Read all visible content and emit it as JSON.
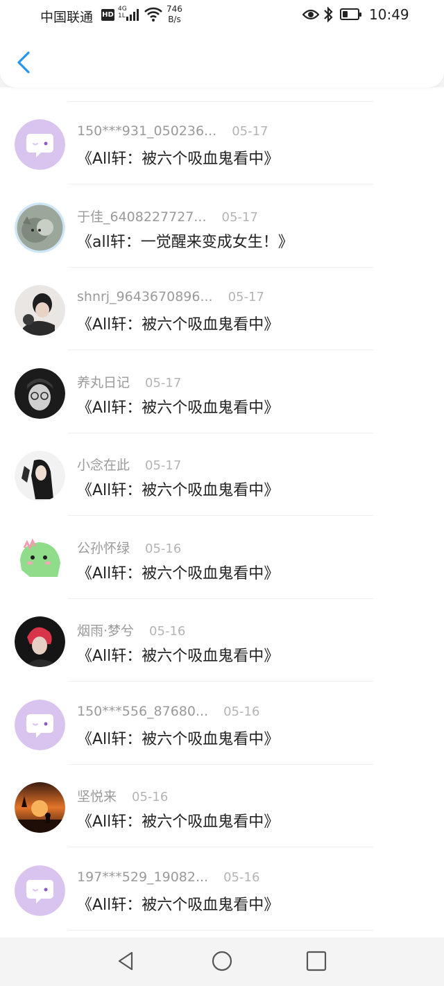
{
  "status_bar": {
    "carrier": "中国联通",
    "hd": "HD",
    "network_top": "4G",
    "network_bottom": "1L",
    "speed_value": "746",
    "speed_unit": "B/s",
    "time": "10:49",
    "battery_level": 0.35
  },
  "header": {
    "back_icon": "chevron-left-icon",
    "accent_color": "#2196f3"
  },
  "items": [
    {
      "name": "150***931_050236...",
      "date": "05-17",
      "title": "《All轩：被六个吸血鬼看中》",
      "avatar": "default-chat"
    },
    {
      "name": "于佳_6408227727...",
      "date": "05-17",
      "title": "《all轩：一觉醒来变成女生！》",
      "avatar": "photo-cat"
    },
    {
      "name": "shnrj_9643670896...",
      "date": "05-17",
      "title": "《All轩：被六个吸血鬼看中》",
      "avatar": "photo-person"
    },
    {
      "name": "养丸日记",
      "date": "05-17",
      "title": "《All轩：被六个吸血鬼看中》",
      "avatar": "photo-glasses"
    },
    {
      "name": "小念在此",
      "date": "05-17",
      "title": "《All轩：被六个吸血鬼看中》",
      "avatar": "photo-girl"
    },
    {
      "name": "公孙怀绿",
      "date": "05-16",
      "title": "《All轩：被六个吸血鬼看中》",
      "avatar": "cartoon-dinosaur"
    },
    {
      "name": "烟雨·梦兮",
      "date": "05-16",
      "title": "《All轩：被六个吸血鬼看中》",
      "avatar": "photo-red-hair"
    },
    {
      "name": "150***556_87680...",
      "date": "05-16",
      "title": "《All轩：被六个吸血鬼看中》",
      "avatar": "default-chat"
    },
    {
      "name": "坚悦来",
      "date": "05-16",
      "title": "《All轩：被六个吸血鬼看中》",
      "avatar": "photo-sunset"
    },
    {
      "name": "197***529_19082...",
      "date": "05-16",
      "title": "《All轩：被六个吸血鬼看中》",
      "avatar": "default-chat"
    }
  ],
  "nav_bar": {
    "back": "triangle-back-icon",
    "home": "circle-home-icon",
    "recents": "square-recents-icon"
  }
}
